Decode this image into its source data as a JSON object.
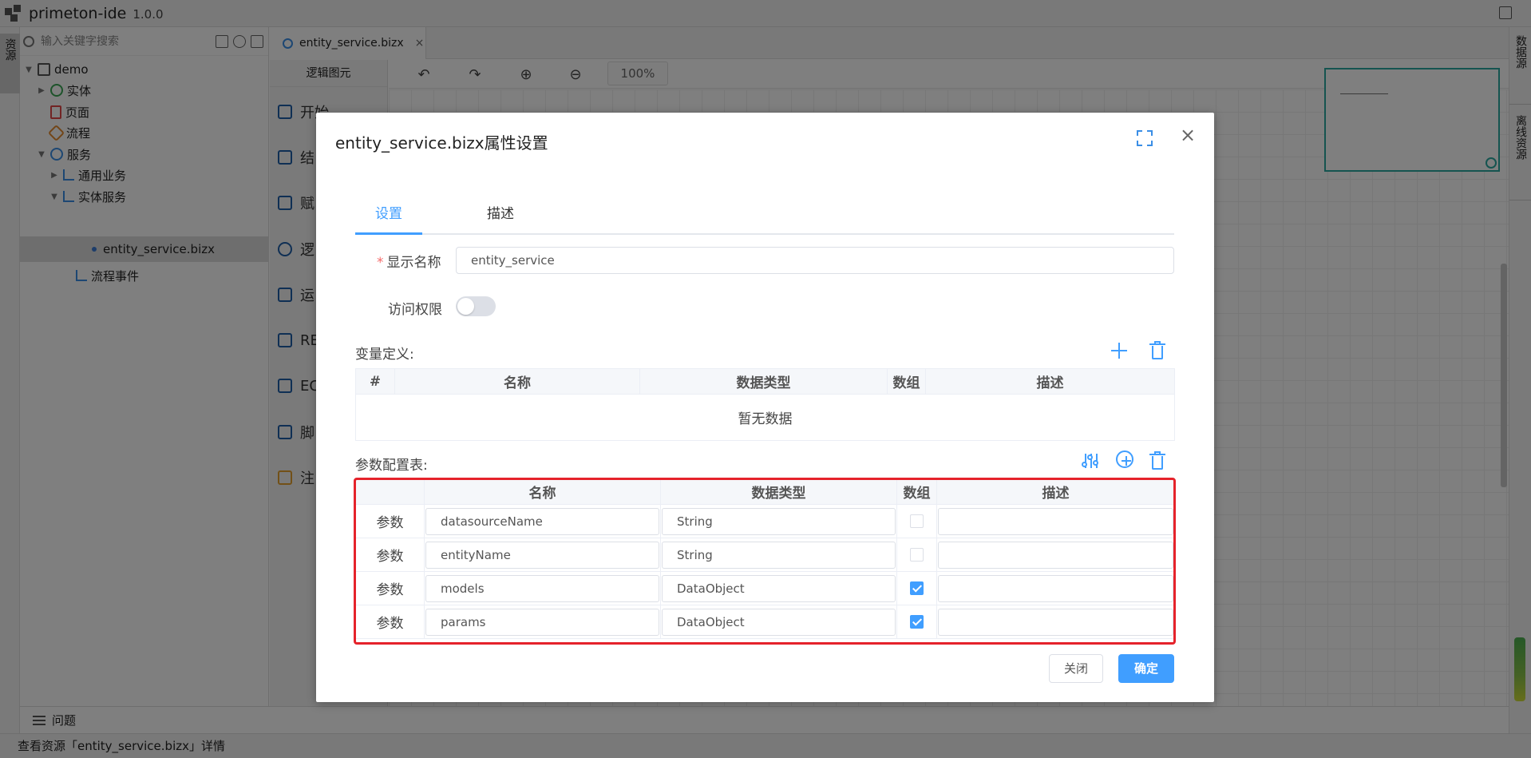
{
  "app": {
    "title": "primeton-ide",
    "version": "1.0.0"
  },
  "left_rail": {
    "resource_tab": "资源"
  },
  "explorer": {
    "search_placeholder": "输入关键字搜索",
    "tree": [
      {
        "label": "demo",
        "icon": "cube-icon"
      },
      {
        "label": "实体",
        "icon": "database-icon"
      },
      {
        "label": "页面",
        "icon": "page-icon"
      },
      {
        "label": "流程",
        "icon": "flow-icon"
      },
      {
        "label": "服务",
        "icon": "gear-icon"
      },
      {
        "label": "通用业务",
        "icon": "service-icon"
      },
      {
        "label": "实体服务",
        "icon": "service-icon"
      },
      {
        "label": "entity_service.bizx",
        "icon": "dot-icon"
      },
      {
        "label": "流程事件",
        "icon": "service-icon"
      }
    ]
  },
  "editor": {
    "tab_label": "entity_service.bizx",
    "tab_close": "×"
  },
  "palette": {
    "title": "逻辑图元",
    "items": [
      "开始",
      "结",
      "赋",
      "逻",
      "运",
      "RE",
      "EC",
      "脚",
      "注"
    ]
  },
  "toolbar": {
    "undo": "↶",
    "redo": "↷",
    "zoom_in": "⊕",
    "zoom_out": "⊖",
    "zoom_level": "100%"
  },
  "right_rail": {
    "datasource_tab": "数据源",
    "offline_tab": "离线资源"
  },
  "problems": {
    "label": "问题"
  },
  "status": {
    "text": "查看资源「entity_service.bizx」详情"
  },
  "dialog": {
    "title": "entity_service.bizx属性设置",
    "close": "×",
    "tabs": [
      {
        "label": "设置",
        "active": true
      },
      {
        "label": "描述",
        "active": false
      }
    ],
    "display_name_label": "显示名称",
    "required_mark": "*",
    "display_name_value": "entity_service",
    "access_label": "访问权限",
    "access_enabled": false,
    "variable_section": "变量定义:",
    "variable_columns": [
      "#",
      "名称",
      "数据类型",
      "数组",
      "描述"
    ],
    "variable_empty": "暂无数据",
    "param_section": "参数配置表:",
    "param_columns": [
      "",
      "名称",
      "数据类型",
      "数组",
      "描述"
    ],
    "params": [
      {
        "kind": "参数",
        "name": "datasourceName",
        "type": "String",
        "is_array": false,
        "desc": ""
      },
      {
        "kind": "参数",
        "name": "entityName",
        "type": "String",
        "is_array": false,
        "desc": ""
      },
      {
        "kind": "参数",
        "name": "models",
        "type": "DataObject",
        "is_array": true,
        "desc": ""
      },
      {
        "kind": "参数",
        "name": "params",
        "type": "DataObject",
        "is_array": true,
        "desc": ""
      }
    ],
    "btn_close": "关闭",
    "btn_ok": "确定",
    "accent": "#409eff",
    "highlight_color": "#e5232b"
  }
}
